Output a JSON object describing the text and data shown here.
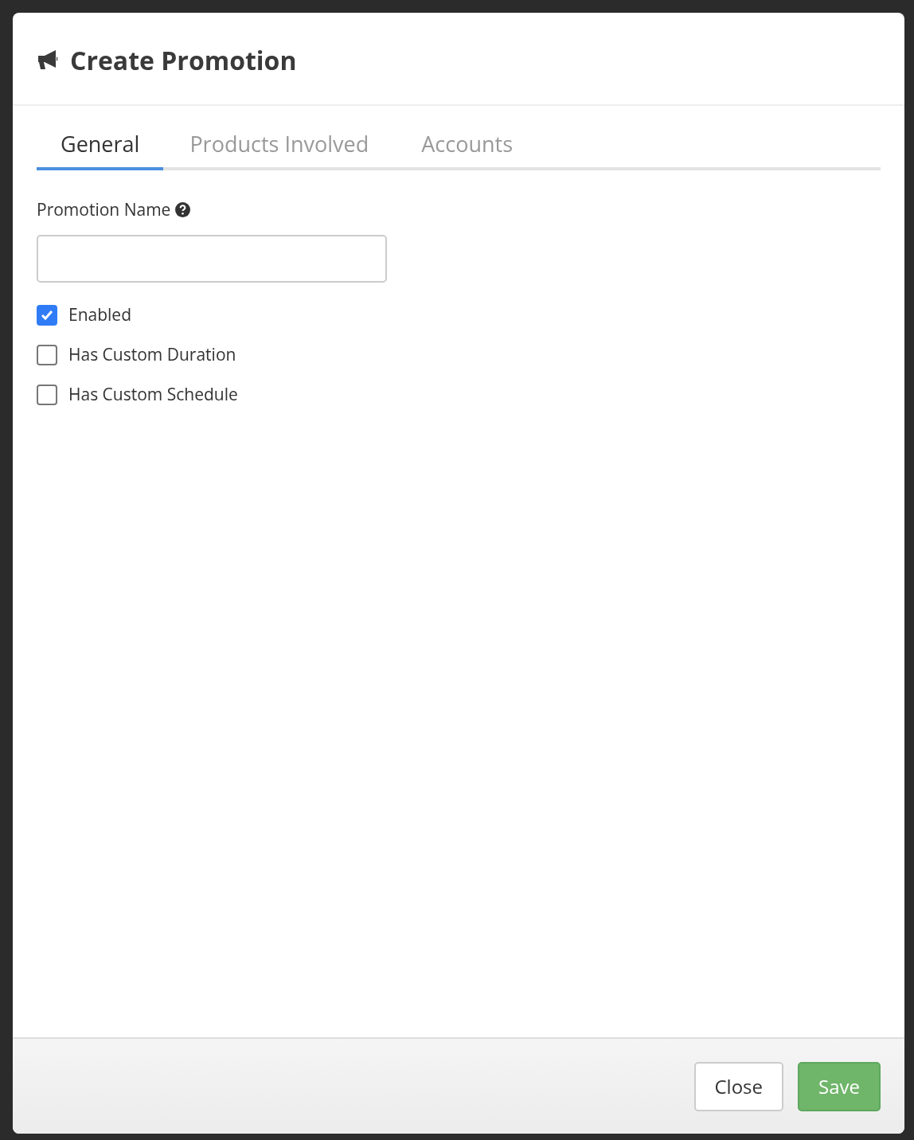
{
  "dialog": {
    "title": "Create Promotion"
  },
  "tabs": [
    {
      "label": "General",
      "selected": true
    },
    {
      "label": "Products Involved",
      "selected": false
    },
    {
      "label": "Accounts",
      "selected": false
    }
  ],
  "form": {
    "name_field": {
      "label": "Promotion Name"
    },
    "checkboxes": [
      {
        "label": "Enabled",
        "checked": true
      },
      {
        "label": "Has Custom Duration",
        "checked": false
      },
      {
        "label": "Has Custom Schedule",
        "checked": false
      }
    ]
  },
  "footer": {
    "buttons": [
      {
        "label": "Close",
        "kind": "default"
      },
      {
        "label": "Save",
        "kind": "primary"
      }
    ]
  }
}
